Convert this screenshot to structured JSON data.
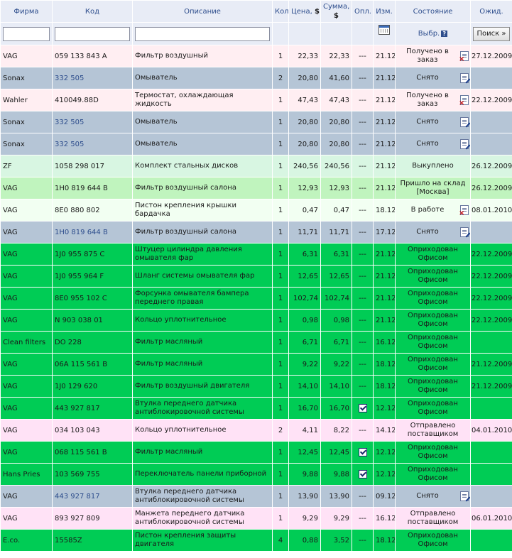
{
  "columns": {
    "firm": "Фирма",
    "code": "Код",
    "desc": "Описание",
    "qty": "Кол",
    "price": "Цена,",
    "price_cur": "$",
    "sum": "Сумма,",
    "sum_cur": "$",
    "paid": "Опл.",
    "changed": "Изм.",
    "state": "Состояние",
    "expected": "Ожид."
  },
  "filters": {
    "firm": "",
    "code": "",
    "desc": "",
    "select_label": "Выбр.",
    "help": "?",
    "search_button": "Поиск »"
  },
  "colors": {
    "pink": "#ffeef2",
    "gray": "#b5c5d6",
    "mint": "#d8f6e2",
    "lime": "#c0f4be",
    "white": "#f2fff2",
    "green": "#00cc55",
    "violet": "#ffe2f6"
  },
  "rows": [
    {
      "firm": "VAG",
      "code": "059 133 843 A",
      "code_link": false,
      "desc": "Фильтр воздушный",
      "qty": "1",
      "price": "22,33",
      "sum": "22,33",
      "paid": "---",
      "changed": "21.12",
      "state": "Получено в заказ",
      "icon": "cancel",
      "expected": "27.12.2009",
      "color": "pink"
    },
    {
      "firm": "Sonax",
      "code": "332 505",
      "code_link": true,
      "desc": "Омыватель",
      "qty": "2",
      "price": "20,80",
      "sum": "41,60",
      "paid": "---",
      "changed": "21.12",
      "state": "Снято",
      "icon": "edit",
      "expected": "",
      "color": "gray"
    },
    {
      "firm": "Wahler",
      "code": "410049.88D",
      "code_link": false,
      "desc": "Термостат, охлаждающая жидкость",
      "qty": "1",
      "price": "47,43",
      "sum": "47,43",
      "paid": "---",
      "changed": "21.12",
      "state": "Получено в заказ",
      "icon": "cancel",
      "expected": "22.12.2009",
      "color": "pink"
    },
    {
      "firm": "Sonax",
      "code": "332 505",
      "code_link": true,
      "desc": "Омыватель",
      "qty": "1",
      "price": "20,80",
      "sum": "20,80",
      "paid": "---",
      "changed": "21.12",
      "state": "Снято",
      "icon": "edit",
      "expected": "",
      "color": "gray"
    },
    {
      "firm": "Sonax",
      "code": "332 505",
      "code_link": true,
      "desc": "Омыватель",
      "qty": "1",
      "price": "20,80",
      "sum": "20,80",
      "paid": "---",
      "changed": "21.12",
      "state": "Снято",
      "icon": "edit",
      "expected": "",
      "color": "gray"
    },
    {
      "firm": "ZF",
      "code": "1058 298 017",
      "code_link": false,
      "desc": "Комплект стальных дисков",
      "qty": "1",
      "price": "240,56",
      "sum": "240,56",
      "paid": "---",
      "changed": "21.12",
      "state": "Выкуплено",
      "icon": "",
      "expected": "26.12.2009",
      "color": "mint"
    },
    {
      "firm": "VAG",
      "code": "1H0 819 644 B",
      "code_link": false,
      "desc": "Фильтр воздушный салона",
      "qty": "1",
      "price": "12,93",
      "sum": "12,93",
      "paid": "---",
      "changed": "21.12",
      "state": "Пришло на склад [Москва]",
      "icon": "",
      "expected": "26.12.2009",
      "color": "lime"
    },
    {
      "firm": "VAG",
      "code": "8E0 880 802",
      "code_link": false,
      "desc": "Пистон крепления крышки бардачка",
      "qty": "1",
      "price": "0,47",
      "sum": "0,47",
      "paid": "---",
      "changed": "18.12",
      "state": "В работе",
      "icon": "cancel",
      "expected": "08.01.2010",
      "color": "white"
    },
    {
      "firm": "VAG",
      "code": "1H0 819 644 B",
      "code_link": true,
      "desc": "Фильтр воздушный салона",
      "qty": "1",
      "price": "11,71",
      "sum": "11,71",
      "paid": "---",
      "changed": "17.12",
      "state": "Снято",
      "icon": "edit",
      "expected": "",
      "color": "gray"
    },
    {
      "firm": "VAG",
      "code": "1J0 955 875 C",
      "code_link": false,
      "desc": "Штуцер цилиндра давления омывателя фар",
      "qty": "1",
      "price": "6,31",
      "sum": "6,31",
      "paid": "---",
      "changed": "21.12",
      "state": "Оприходован Офисом",
      "icon": "",
      "expected": "22.12.2009",
      "color": "green"
    },
    {
      "firm": "VAG",
      "code": "1J0 955 964 F",
      "code_link": false,
      "desc": "Шланг системы омывателя фар",
      "qty": "1",
      "price": "12,65",
      "sum": "12,65",
      "paid": "---",
      "changed": "21.12",
      "state": "Оприходован Офисом",
      "icon": "",
      "expected": "22.12.2009",
      "color": "green"
    },
    {
      "firm": "VAG",
      "code": "8E0 955 102 C",
      "code_link": false,
      "desc": "Форсунка омывателя бампера переднего правая",
      "qty": "1",
      "price": "102,74",
      "sum": "102,74",
      "paid": "---",
      "changed": "21.12",
      "state": "Оприходован Офисом",
      "icon": "",
      "expected": "22.12.2009",
      "color": "green"
    },
    {
      "firm": "VAG",
      "code": "N 903 038 01",
      "code_link": false,
      "desc": "Кольцо уплотнительное",
      "qty": "1",
      "price": "0,98",
      "sum": "0,98",
      "paid": "---",
      "changed": "21.12",
      "state": "Оприходован Офисом",
      "icon": "",
      "expected": "22.12.2009",
      "color": "green"
    },
    {
      "firm": "Clean filters",
      "code": "DO 228",
      "code_link": false,
      "desc": "Фильтр масляный",
      "qty": "1",
      "price": "6,71",
      "sum": "6,71",
      "paid": "---",
      "changed": "16.12",
      "state": "Оприходован Офисом",
      "icon": "",
      "expected": "",
      "color": "green"
    },
    {
      "firm": "VAG",
      "code": "06A 115 561 B",
      "code_link": false,
      "desc": "Фильтр масляный",
      "qty": "1",
      "price": "9,22",
      "sum": "9,22",
      "paid": "---",
      "changed": "18.12",
      "state": "Оприходован Офисом",
      "icon": "",
      "expected": "21.12.2009",
      "color": "green"
    },
    {
      "firm": "VAG",
      "code": "1J0 129 620",
      "code_link": false,
      "desc": "Фильтр воздушный двигателя",
      "qty": "1",
      "price": "14,10",
      "sum": "14,10",
      "paid": "---",
      "changed": "18.12",
      "state": "Оприходован Офисом",
      "icon": "",
      "expected": "21.12.2009",
      "color": "green"
    },
    {
      "firm": "VAG",
      "code": "443 927 817",
      "code_link": false,
      "desc": "Втулка переднего датчика антиблокировочной системы",
      "qty": "1",
      "price": "16,70",
      "sum": "16,70",
      "paid": "checked",
      "changed": "12.12",
      "state": "Оприходован Офисом",
      "icon": "",
      "expected": "",
      "color": "green"
    },
    {
      "firm": "VAG",
      "code": "034 103 043",
      "code_link": false,
      "desc": "Кольцо уплотнительное",
      "qty": "2",
      "price": "4,11",
      "sum": "8,22",
      "paid": "---",
      "changed": "14.12",
      "state": "Отправлено поставщиком",
      "icon": "",
      "expected": "04.01.2010",
      "color": "violet"
    },
    {
      "firm": "VAG",
      "code": "068 115 561 B",
      "code_link": false,
      "desc": "Фильтр масляный",
      "qty": "1",
      "price": "12,45",
      "sum": "12,45",
      "paid": "checked",
      "changed": "12.12",
      "state": "Оприходован Офисом",
      "icon": "",
      "expected": "",
      "color": "green"
    },
    {
      "firm": "Hans Pries",
      "code": "103 569 755",
      "code_link": false,
      "desc": "Переключатель панели приборной",
      "qty": "1",
      "price": "9,88",
      "sum": "9,88",
      "paid": "checked",
      "changed": "12.12",
      "state": "Оприходован Офисом",
      "icon": "",
      "expected": "",
      "color": "green"
    },
    {
      "firm": "VAG",
      "code": "443 927 817",
      "code_link": true,
      "desc": "Втулка переднего датчика антиблокировочной системы",
      "qty": "1",
      "price": "13,90",
      "sum": "13,90",
      "paid": "---",
      "changed": "09.12",
      "state": "Снято",
      "icon": "edit",
      "expected": "",
      "color": "gray"
    },
    {
      "firm": "VAG",
      "code": "893 927 809",
      "code_link": false,
      "desc": "Манжета переднего датчика антиблокировочной системы",
      "qty": "1",
      "price": "9,29",
      "sum": "9,29",
      "paid": "---",
      "changed": "16.12",
      "state": "Отправлено поставщиком",
      "icon": "",
      "expected": "06.01.2010",
      "color": "violet"
    },
    {
      "firm": "E.co.",
      "code": "15585Z",
      "code_link": false,
      "desc": "Пистон крепления защиты двигателя",
      "qty": "4",
      "price": "0,88",
      "sum": "3,52",
      "paid": "---",
      "changed": "18.12",
      "state": "Оприходован Офисом",
      "icon": "",
      "expected": "",
      "color": "green"
    }
  ]
}
